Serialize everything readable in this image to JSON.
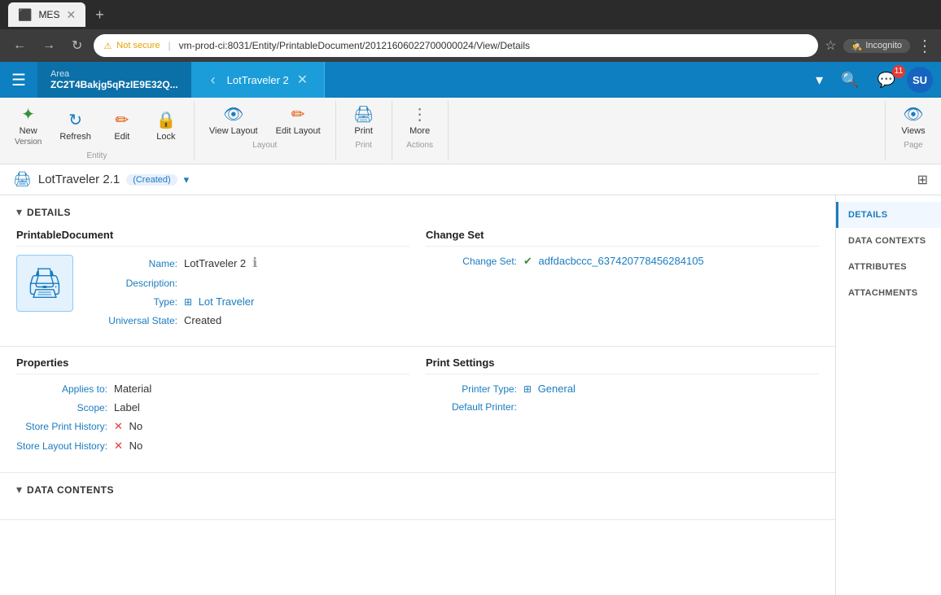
{
  "browser": {
    "tabs": [
      {
        "id": "mes",
        "title": "MES",
        "active": true
      },
      {
        "id": "new",
        "title": "+",
        "active": false
      }
    ],
    "active_tab": "MES",
    "url_warning": "Not secure",
    "url": "vm-prod-ci:8031/Entity/PrintableDocument/20121606022700000024/View/Details",
    "incognito_label": "Incognito"
  },
  "app_header": {
    "area_label": "Area",
    "area_value": "ZC2T4Bakjg5qRzIE9E32Q...",
    "tab_title": "LotTraveler 2",
    "dropdown_arrow": "▾"
  },
  "toolbar": {
    "entity_group_label": "Entity",
    "layout_group_label": "Layout",
    "print_group_label": "Print",
    "actions_group_label": "Actions",
    "page_group_label": "Page",
    "buttons": {
      "new_version": {
        "label": "New",
        "sublabel": "Version"
      },
      "refresh": {
        "label": "Refresh"
      },
      "edit": {
        "label": "Edit"
      },
      "lock": {
        "label": "Lock"
      },
      "view_layout": {
        "label": "View Layout"
      },
      "edit_layout": {
        "label": "Edit Layout"
      },
      "print": {
        "label": "Print"
      },
      "more": {
        "label": "More"
      },
      "views": {
        "label": "Views"
      }
    }
  },
  "page": {
    "title": "LotTraveler 2.1",
    "badge": "(Created)",
    "printer_icon": "🖨"
  },
  "details_section": {
    "title": "DETAILS",
    "printable_document": {
      "heading": "PrintableDocument",
      "name_label": "Name:",
      "name_value": "LotTraveler 2",
      "description_label": "Description:",
      "description_value": "",
      "type_label": "Type:",
      "type_value": "Lot Traveler",
      "universal_state_label": "Universal State:",
      "universal_state_value": "Created"
    },
    "change_set": {
      "heading": "Change Set",
      "change_set_label": "Change Set:",
      "change_set_value": "adfdacbccc_637420778456284105"
    }
  },
  "properties_section": {
    "heading_left": "Properties",
    "heading_right": "Print Settings",
    "applies_to_label": "Applies to:",
    "applies_to_value": "Material",
    "scope_label": "Scope:",
    "scope_value": "Label",
    "store_print_label": "Store Print History:",
    "store_print_value": "No",
    "store_layout_label": "Store Layout History:",
    "store_layout_value": "No",
    "printer_type_label": "Printer Type:",
    "printer_type_value": "General",
    "default_printer_label": "Default Printer:",
    "default_printer_value": ""
  },
  "data_contents_label": "DATA CONTENTS",
  "right_sidebar": {
    "items": [
      {
        "id": "details",
        "label": "DETAILS",
        "active": true
      },
      {
        "id": "data-contexts",
        "label": "DATA CONTEXTS",
        "active": false
      },
      {
        "id": "attributes",
        "label": "ATTRIBUTES",
        "active": false
      },
      {
        "id": "attachments",
        "label": "ATTACHMENTS",
        "active": false
      }
    ]
  },
  "notification_count": "11"
}
